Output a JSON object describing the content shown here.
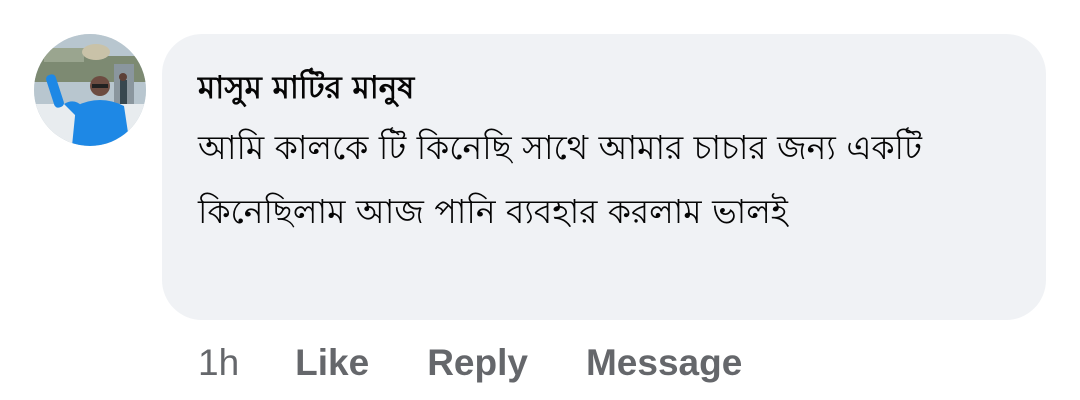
{
  "comment": {
    "author": "মাসুম মাটির মানুষ",
    "text": "আমি কালকে টি কিনেছি সাথে আমার চাচার জন্য একটি কিনেছিলাম আজ পানি ব্যবহার করলাম ভালই",
    "time": "1h",
    "actions": {
      "like": "Like",
      "reply": "Reply",
      "message": "Message"
    }
  },
  "colors": {
    "bubble_bg": "#f0f2f5",
    "text": "#050505",
    "secondary_text": "#65676b",
    "avatar_shirt": "#1e88e5"
  }
}
